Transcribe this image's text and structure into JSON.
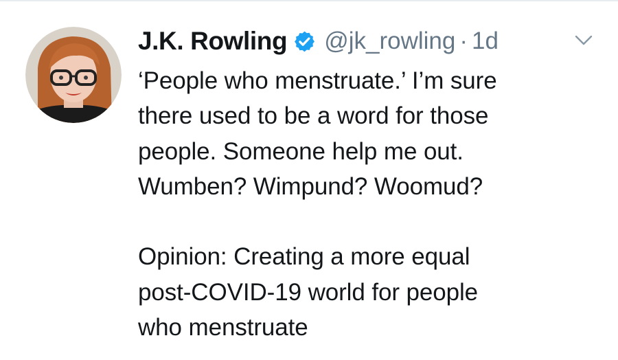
{
  "tweet": {
    "author": {
      "display_name": "J.K. Rowling",
      "handle": "@jk_rowling",
      "verified": true,
      "avatar_icon": "profile-photo"
    },
    "separator": "·",
    "timestamp": "1d",
    "menu_icon": "chevron-down-icon",
    "body_lines": [
      "‘People who menstruate.’ I’m sure",
      "there used to be a word for those",
      "people. Someone help me out.",
      "Wumben? Wimpund? Woomud?"
    ],
    "quoted_headline_lines": [
      "Opinion: Creating a more equal",
      "post-COVID-19 world for people",
      "who menstruate"
    ]
  },
  "colors": {
    "text_primary": "#14171a",
    "text_secondary": "#657786",
    "verified_blue": "#1da1f2",
    "divider": "#e6ecf0"
  }
}
